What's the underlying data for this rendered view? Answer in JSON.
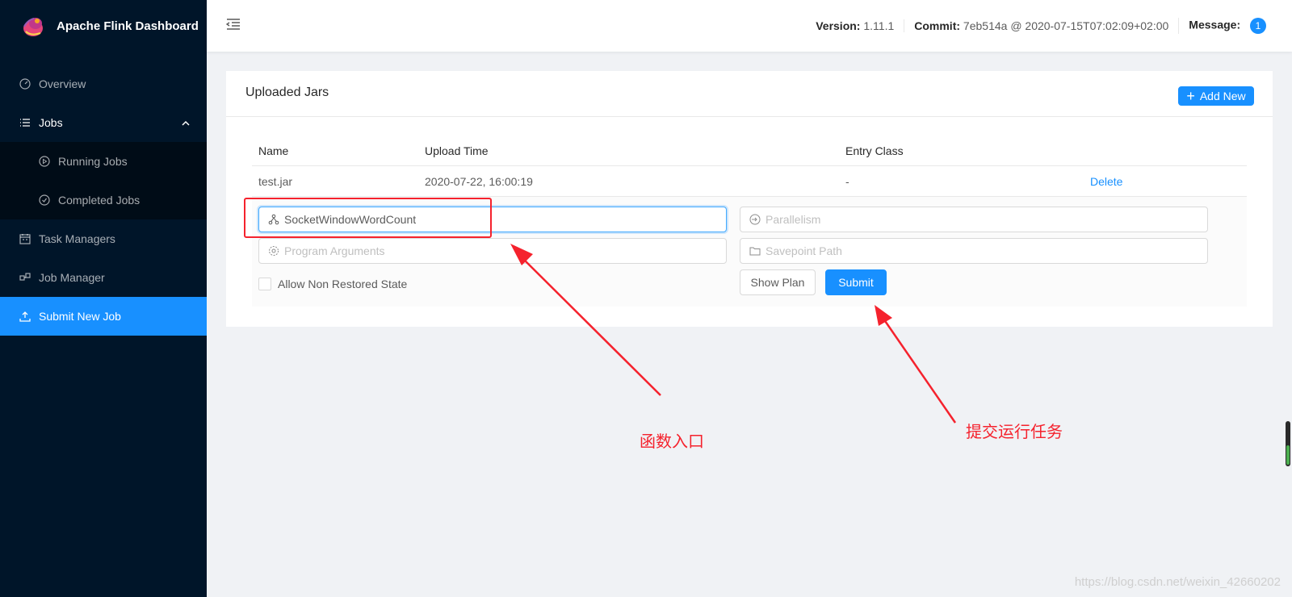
{
  "app": {
    "title": "Apache Flink Dashboard"
  },
  "sidebar": {
    "items": [
      {
        "label": "Overview",
        "icon": "dashboard-icon"
      },
      {
        "label": "Jobs",
        "icon": "list-icon",
        "expanded": true,
        "children": [
          {
            "label": "Running Jobs",
            "icon": "play-circle-icon"
          },
          {
            "label": "Completed Jobs",
            "icon": "check-circle-icon"
          }
        ]
      },
      {
        "label": "Task Managers",
        "icon": "schedule-icon"
      },
      {
        "label": "Job Manager",
        "icon": "build-icon"
      },
      {
        "label": "Submit New Job",
        "icon": "upload-icon",
        "active": true
      }
    ]
  },
  "header": {
    "version_label": "Version:",
    "version_value": "1.11.1",
    "commit_label": "Commit:",
    "commit_value": "7eb514a @ 2020-07-15T07:02:09+02:00",
    "message_label": "Message:",
    "message_count": "1"
  },
  "card": {
    "title": "Uploaded Jars",
    "add_button": "Add New",
    "columns": [
      "Name",
      "Upload Time",
      "Entry Class"
    ],
    "rows": [
      {
        "name": "test.jar",
        "upload_time": "2020-07-22, 16:00:19",
        "entry_class": "-",
        "action": "Delete"
      }
    ]
  },
  "form": {
    "entry_class_value": "SocketWindowWordCount",
    "parallelism_placeholder": "Parallelism",
    "program_args_placeholder": "Program Arguments",
    "savepoint_placeholder": "Savepoint Path",
    "allow_non_restored": "Allow Non Restored State",
    "show_plan": "Show Plan",
    "submit": "Submit"
  },
  "annotations": {
    "entry_note": "函数入口",
    "submit_note": "提交运行任务",
    "color": "#f5222d"
  },
  "watermark": "https://blog.csdn.net/weixin_42660202",
  "colors": {
    "primary": "#1890ff",
    "sidebar_bg": "#001529",
    "submenu_bg": "#000c17"
  }
}
